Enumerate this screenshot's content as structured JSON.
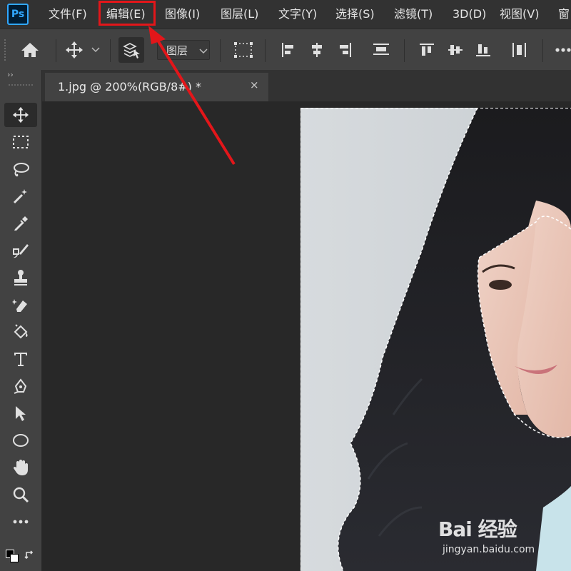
{
  "app": {
    "logo_text": "Ps",
    "brand_color": "#31a8ff"
  },
  "menu": {
    "items": [
      "文件(F)",
      "编辑(E)",
      "图像(I)",
      "图层(L)",
      "文字(Y)",
      "选择(S)",
      "滤镜(T)",
      "3D(D)",
      "视图(V)",
      "窗"
    ],
    "highlighted": "编辑(E)",
    "highlight_color": "#e3161a"
  },
  "options": {
    "layer_select_value": "图层"
  },
  "document": {
    "tab_label": "1.jpg @ 200%(RGB/8#) *",
    "close_glyph": "×"
  },
  "tools": [
    "move-tool",
    "marquee-tool",
    "lasso-tool",
    "magic-wand-tool",
    "eyedropper-tool",
    "brush-tool",
    "stamp-tool",
    "eraser-tool",
    "paint-bucket-tool",
    "type-tool",
    "pen-tool",
    "path-selection-tool",
    "ellipse-tool",
    "hand-tool",
    "zoom-tool",
    "more-tools"
  ],
  "toolbar_collapse_glyph": "››",
  "watermark": {
    "main": "Bai 经验",
    "sub": "jingyan.baidu.com"
  }
}
